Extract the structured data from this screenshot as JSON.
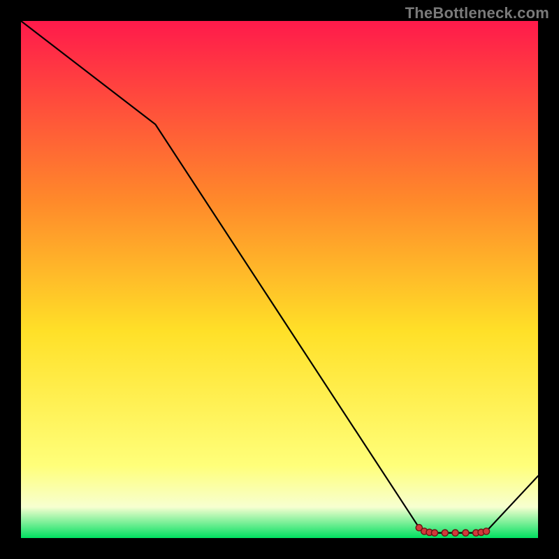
{
  "watermark": "TheBottleneck.com",
  "colors": {
    "gradient_top": "#ff1a4b",
    "gradient_mid_upper": "#ff8a2a",
    "gradient_mid": "#ffe028",
    "gradient_lower": "#ffff7a",
    "gradient_near_bottom": "#f7ffd0",
    "gradient_bottom": "#00e060",
    "curve": "#000000",
    "marker_fill": "#d23a3a",
    "marker_stroke": "#6a1414",
    "frame": "#000000"
  },
  "chart_data": {
    "type": "line",
    "title": "",
    "xlabel": "",
    "ylabel": "",
    "xlim": [
      0,
      100
    ],
    "ylim": [
      0,
      100
    ],
    "series": [
      {
        "name": "curve",
        "x": [
          0,
          26,
          77,
          78,
          79,
          80,
          82,
          84,
          86,
          88,
          89,
          90,
          100
        ],
        "values": [
          100,
          80,
          2.0,
          1.3,
          1.1,
          1.0,
          1.0,
          1.0,
          1.0,
          1.0,
          1.1,
          1.3,
          12
        ]
      }
    ],
    "markers": {
      "name": "highlight-points",
      "x": [
        77,
        78,
        79,
        80,
        82,
        84,
        86,
        88,
        89,
        90
      ],
      "values": [
        2.0,
        1.3,
        1.1,
        1.0,
        1.0,
        1.0,
        1.0,
        1.0,
        1.1,
        1.3
      ]
    }
  }
}
